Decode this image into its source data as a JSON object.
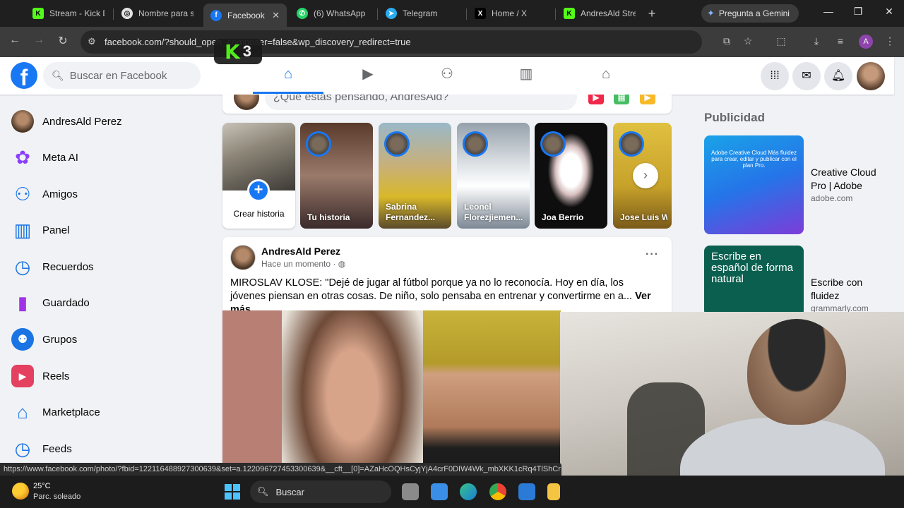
{
  "browser": {
    "tabs": [
      {
        "title": "Stream - Kick Da",
        "icon": "kick-icon",
        "color": "#53fc18"
      },
      {
        "title": "Nombre para st",
        "icon": "chatgpt-icon",
        "color": "#e3e3e3"
      },
      {
        "title": "Facebook",
        "icon": "facebook-icon",
        "color": "#1877f2",
        "active": true
      },
      {
        "title": "(6) WhatsApp",
        "icon": "whatsapp-icon",
        "color": "#25d366"
      },
      {
        "title": "Telegram",
        "icon": "telegram-icon",
        "color": "#2aabee"
      },
      {
        "title": "Home / X",
        "icon": "x-icon",
        "color": "#ffffff"
      },
      {
        "title": "AndresAld Strea",
        "icon": "kick-icon",
        "color": "#53fc18"
      }
    ],
    "gemini_label": "Pregunta a Gemini",
    "url": "facebook.com/?should_open_composer=false&wp_discovery_redirect=true",
    "profile_initial": "A",
    "status_url": "https://www.facebook.com/photo/?fbid=122116488927300639&set=a.122096727453300639&__cft__[0]=AZaHcOQHsCyjYjA4crF0DIW4Wk_mbXKK1cRq4TlShCr"
  },
  "overlay": {
    "k3_letter": "K",
    "k3_number": "3"
  },
  "facebook": {
    "logo": "f",
    "search_placeholder": "Buscar en Facebook",
    "composer_placeholder": "¿Qué estás pensando, AndresAld?",
    "sidebar": [
      {
        "label": "AndresAld Perez",
        "icon": "profile-avatar",
        "color": "#6b5444"
      },
      {
        "label": "Meta AI",
        "icon": "meta-ai-icon",
        "color": "#8a3ffc"
      },
      {
        "label": "Amigos",
        "icon": "friends-icon",
        "color": "#1b74e4"
      },
      {
        "label": "Panel",
        "icon": "dashboard-icon",
        "color": "#1b74e4"
      },
      {
        "label": "Recuerdos",
        "icon": "memories-icon",
        "color": "#1b74e4"
      },
      {
        "label": "Guardado",
        "icon": "saved-icon",
        "color": "#a033e8"
      },
      {
        "label": "Grupos",
        "icon": "groups-icon",
        "color": "#1b74e4"
      },
      {
        "label": "Reels",
        "icon": "reels-icon",
        "color": "#e4405f"
      },
      {
        "label": "Marketplace",
        "icon": "marketplace-icon",
        "color": "#1b74e4"
      },
      {
        "label": "Feeds",
        "icon": "feeds-icon",
        "color": "#1b74e4"
      }
    ],
    "stories": {
      "create_label": "Crear historia",
      "items": [
        {
          "name": "Tu historia",
          "bg": "#4a3a3a"
        },
        {
          "name": "Sabrina Fernandez...",
          "bg": "#b99f3a"
        },
        {
          "name": "Leonel Florezjiemen...",
          "bg": "#7b8794"
        },
        {
          "name": "Joa Berrio",
          "bg": "#0e0e0e"
        },
        {
          "name": "Jose Luis Wos",
          "bg": "#c7a22a"
        }
      ]
    },
    "post": {
      "author": "AndresAld Perez",
      "time": "Hace un momento · ",
      "text": "MIROSLAV KLOSE: \"Dejé de jugar al fútbol porque ya no lo reconocía. Hoy en día, los jóvenes piensan en otras cosas. De niño, solo pensaba en entrenar y convertirme en a...",
      "see_more": "Ver más",
      "more_label": "···"
    },
    "ads": {
      "title": "Publicidad",
      "items": [
        {
          "title": "Creative Cloud Pro | Adobe",
          "url": "adobe.com",
          "image_text": "Adobe Creative Cloud Más fluidez para crear, editar y publicar con el plan Pro."
        },
        {
          "title": "Escribe con fluidez",
          "url": "grammarly.com",
          "image_text": "Escribe en español de forma natural"
        }
      ]
    }
  },
  "taskbar": {
    "temp": "25°C",
    "weather": "Parc. soleado",
    "search_label": "Buscar"
  }
}
